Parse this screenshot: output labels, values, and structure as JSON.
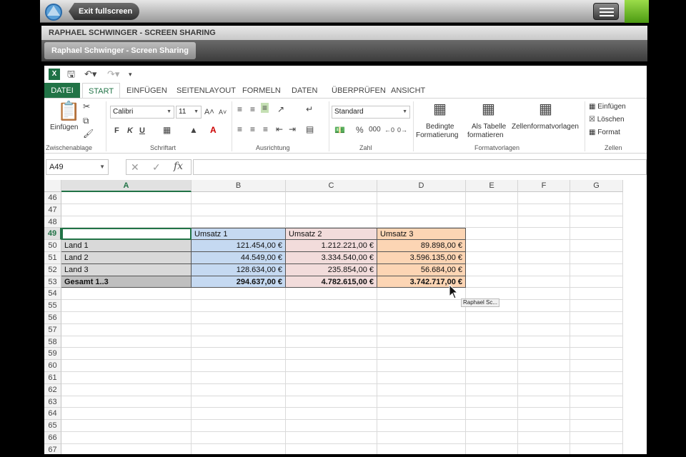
{
  "topbar": {
    "exit_label": "Exit fullscreen"
  },
  "share": {
    "title": "RAPHAEL SCHWINGER - SCREEN SHARING",
    "tab": "Raphael Schwinger - Screen Sharing"
  },
  "excel": {
    "tabs": [
      "DATEI",
      "START",
      "EINFÜGEN",
      "SEITENLAYOUT",
      "FORMELN",
      "DATEN",
      "ÜBERPRÜFEN",
      "ANSICHT"
    ],
    "active_tab": "START",
    "groups": {
      "clipboard": {
        "label": "Zwischenablage",
        "paste": "Einfügen"
      },
      "font": {
        "label": "Schriftart",
        "font_name": "Calibri",
        "font_size": "11",
        "bold": "F",
        "italic": "K",
        "underline": "U"
      },
      "alignment": {
        "label": "Ausrichtung"
      },
      "number": {
        "label": "Zahl",
        "format": "Standard"
      },
      "styles": {
        "label": "Formatvorlagen",
        "conditional_1": "Bedingte",
        "conditional_2": "Formatierung",
        "table_1": "Als Tabelle",
        "table_2": "formatieren",
        "cell_styles": "Zellenformatvorlagen"
      },
      "cells": {
        "label": "Zellen",
        "insert": "Einfügen",
        "delete": "Löschen",
        "format": "Format"
      }
    },
    "name_box": "A49",
    "columns": [
      "A",
      "B",
      "C",
      "D",
      "E",
      "F",
      "G"
    ],
    "rows": [
      {
        "n": "46",
        "cells": [
          "",
          "",
          "",
          ""
        ]
      },
      {
        "n": "47",
        "cells": [
          "",
          "",
          "",
          ""
        ]
      },
      {
        "n": "48",
        "cells": [
          "",
          "",
          "",
          ""
        ]
      },
      {
        "n": "49",
        "cells": [
          "",
          "Umsatz 1",
          "Umsatz 2",
          "Umsatz 3"
        ]
      },
      {
        "n": "50",
        "cells": [
          "Land 1",
          "121.454,00 €",
          "1.212.221,00 €",
          "89.898,00 €"
        ]
      },
      {
        "n": "51",
        "cells": [
          "Land 2",
          "44.549,00 €",
          "3.334.540,00 €",
          "3.596.135,00 €"
        ]
      },
      {
        "n": "52",
        "cells": [
          "Land 3",
          "128.634,00 €",
          "235.854,00 €",
          "56.684,00 €"
        ]
      },
      {
        "n": "53",
        "cells": [
          "Gesamt 1..3",
          "294.637,00 €",
          "4.782.615,00 €",
          "3.742.717,00 €"
        ]
      },
      {
        "n": "54",
        "cells": [
          "",
          "",
          "",
          ""
        ]
      },
      {
        "n": "55",
        "cells": [
          "",
          "",
          "",
          ""
        ]
      },
      {
        "n": "56",
        "cells": [
          "",
          "",
          "",
          ""
        ]
      },
      {
        "n": "57",
        "cells": [
          "",
          "",
          "",
          ""
        ]
      },
      {
        "n": "58",
        "cells": [
          "",
          "",
          "",
          ""
        ]
      },
      {
        "n": "59",
        "cells": [
          "",
          "",
          "",
          ""
        ]
      },
      {
        "n": "60",
        "cells": [
          "",
          "",
          "",
          ""
        ]
      },
      {
        "n": "61",
        "cells": [
          "",
          "",
          "",
          ""
        ]
      },
      {
        "n": "62",
        "cells": [
          "",
          "",
          "",
          ""
        ]
      },
      {
        "n": "63",
        "cells": [
          "",
          "",
          "",
          ""
        ]
      },
      {
        "n": "64",
        "cells": [
          "",
          "",
          "",
          ""
        ]
      },
      {
        "n": "65",
        "cells": [
          "",
          "",
          "",
          ""
        ]
      },
      {
        "n": "66",
        "cells": [
          "",
          "",
          "",
          ""
        ]
      },
      {
        "n": "67",
        "cells": [
          "",
          "",
          "",
          ""
        ]
      }
    ],
    "colors": {
      "col_a": "#d9d9d9",
      "col_a_total": "#bfbfbf",
      "col_b": "#c5d9f1",
      "col_c": "#f2dcdb",
      "col_d": "#fcd5b4",
      "accent": "#217346"
    }
  },
  "cursor_label": "Raphael Sc..."
}
